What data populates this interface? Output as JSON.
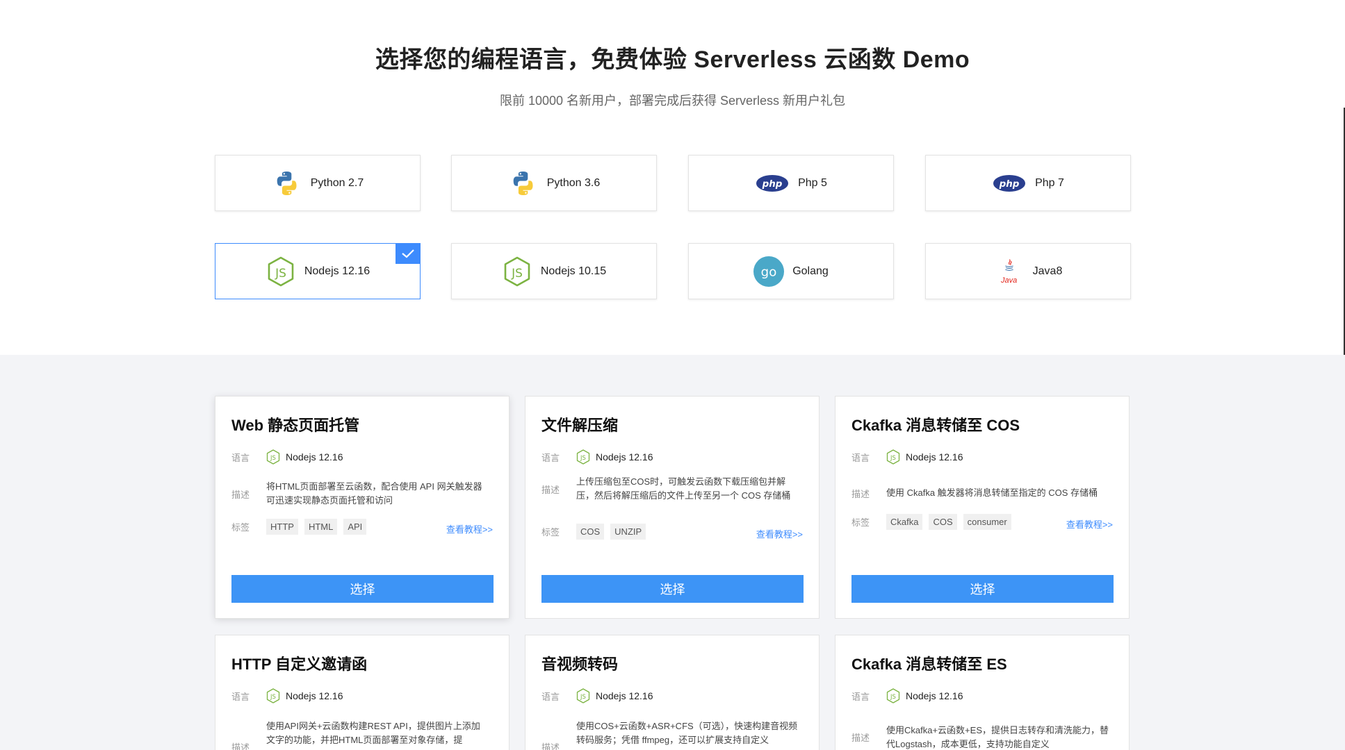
{
  "header": {
    "title": "选择您的编程语言，免费体验 Serverless 云函数 Demo",
    "subtitle": "限前 10000 名新用户，部署完成后获得 Serverless 新用户礼包"
  },
  "languages": [
    {
      "label": "Python 2.7",
      "icon": "python-icon",
      "selected": false
    },
    {
      "label": "Python 3.6",
      "icon": "python-icon",
      "selected": false
    },
    {
      "label": "Php 5",
      "icon": "php-icon",
      "selected": false
    },
    {
      "label": "Php 7",
      "icon": "php-icon",
      "selected": false
    },
    {
      "label": "Nodejs 12.16",
      "icon": "nodejs-icon",
      "selected": true
    },
    {
      "label": "Nodejs 10.15",
      "icon": "nodejs-icon",
      "selected": false
    },
    {
      "label": "Golang",
      "icon": "golang-icon",
      "selected": false
    },
    {
      "label": "Java8",
      "icon": "java-icon",
      "selected": false
    }
  ],
  "labels": {
    "lang": "语言",
    "desc": "描述",
    "tags": "标签",
    "tutorial": "查看教程>>",
    "select": "选择"
  },
  "java_logo_text": "Java",
  "demos": [
    {
      "title": "Web 静态页面托管",
      "lang": "Nodejs 12.16",
      "desc": "将HTML页面部署至云函数，配合使用 API 网关触发器可迅速实现静态页面托管和访问",
      "tags": [
        "HTTP",
        "HTML",
        "API"
      ]
    },
    {
      "title": "文件解压缩",
      "lang": "Nodejs 12.16",
      "desc": "上传压缩包至COS时，可触发云函数下载压缩包并解压，然后将解压缩后的文件上传至另一个 COS 存储桶",
      "tags": [
        "COS",
        "UNZIP"
      ]
    },
    {
      "title": "Ckafka 消息转储至 COS",
      "lang": "Nodejs 12.16",
      "desc": "使用 Ckafka 触发器将消息转储至指定的 COS 存储桶",
      "tags": [
        "Ckafka",
        "COS",
        "consumer"
      ]
    },
    {
      "title": "HTTP 自定义邀请函",
      "lang": "Nodejs 12.16",
      "desc": "使用API网关+云函数构建REST API，提供图片上添加文字的功能，并把HTML页面部署至对象存储，提"
    },
    {
      "title": "音视频转码",
      "lang": "Nodejs 12.16",
      "desc": "使用COS+云函数+ASR+CFS（可选），快速构建音视频转码服务；凭借 ffmpeg，还可以扩展支持自定义"
    },
    {
      "title": "Ckafka 消息转储至 ES",
      "lang": "Nodejs 12.16",
      "desc": "使用Ckafka+云函数+ES，提供日志转存和清洗能力，替代Logstash，成本更低，支持功能自定义"
    }
  ],
  "colors": {
    "accent": "#3d94f6",
    "selected_border": "#3d8bfd",
    "node_green": "#7cb342",
    "php_blue": "#2a3f8f",
    "go_teal": "#4aa8c8"
  }
}
